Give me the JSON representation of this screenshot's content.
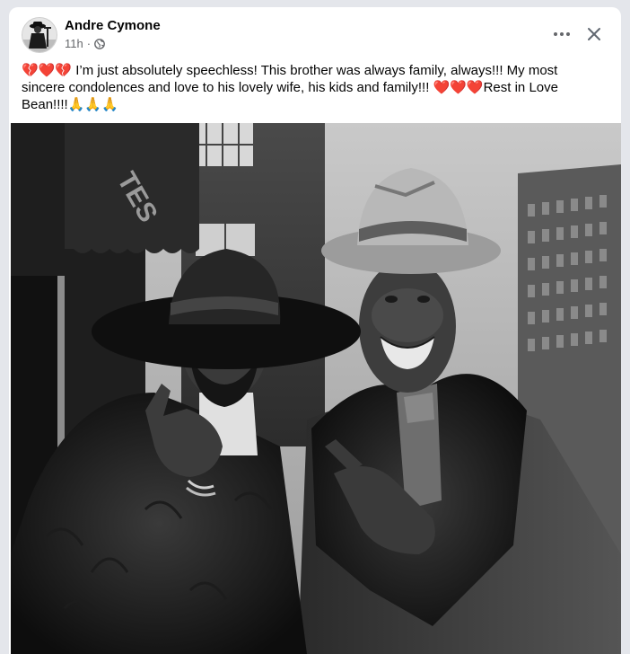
{
  "post": {
    "author": "Andre Cymone",
    "time": "11h",
    "separator": "·",
    "privacy_icon": "globe-icon",
    "text": "💔❤️💔 I’m just absolutely speechless! This brother was always family, always!!! My most sincere condolences and love to his lovely wife, his kids and family!!! ❤️❤️❤️Rest in Love Bean!!!!🙏🙏🙏"
  },
  "actions": {
    "more_icon": "more-horizontal-icon",
    "close_icon": "close-icon"
  },
  "photo": {
    "description_type": "black-and-white photograph of two men in hats and fur coats",
    "awning_text": "TES"
  },
  "colors": {
    "page_background": "#e4e6eb",
    "card_background": "#ffffff",
    "primary_text": "#050505",
    "secondary_text": "#65676b"
  }
}
